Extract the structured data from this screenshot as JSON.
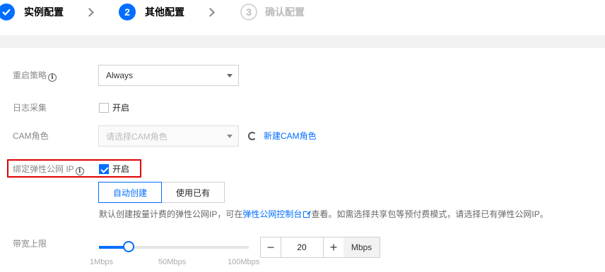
{
  "steps": [
    {
      "num": "",
      "label": "实例配置",
      "state": "done"
    },
    {
      "num": "2",
      "label": "其他配置",
      "state": "active"
    },
    {
      "num": "3",
      "label": "确认配置",
      "state": "todo"
    }
  ],
  "restart_policy": {
    "label": "重启策略",
    "value": "Always"
  },
  "log_collection": {
    "label": "日志采集",
    "checkbox_label": "开启",
    "checked": false
  },
  "cam_role": {
    "label": "CAM角色",
    "placeholder": "请选择CAM角色",
    "new_link": "新建CAM角色"
  },
  "eip": {
    "label": "绑定弹性公网 IP",
    "checkbox_label": "开启",
    "checked": true,
    "options": [
      "自动创建",
      "使用已有"
    ],
    "selected": "自动创建",
    "hint_before": "默认创建按量计费的弹性公网IP，可在",
    "hint_link": "弹性公网控制台",
    "hint_after": "查看。如需选择共享包等预付费模式，请选择已有弹性公网IP。"
  },
  "bandwidth": {
    "label": "带宽上限",
    "value": "20",
    "unit": "Mbps",
    "min_label": "1Mbps",
    "mid_label": "50Mbps",
    "max_label": "100Mbps",
    "level": 0.2
  },
  "colors": {
    "accent": "#006eff",
    "highlight": "#e00000"
  }
}
